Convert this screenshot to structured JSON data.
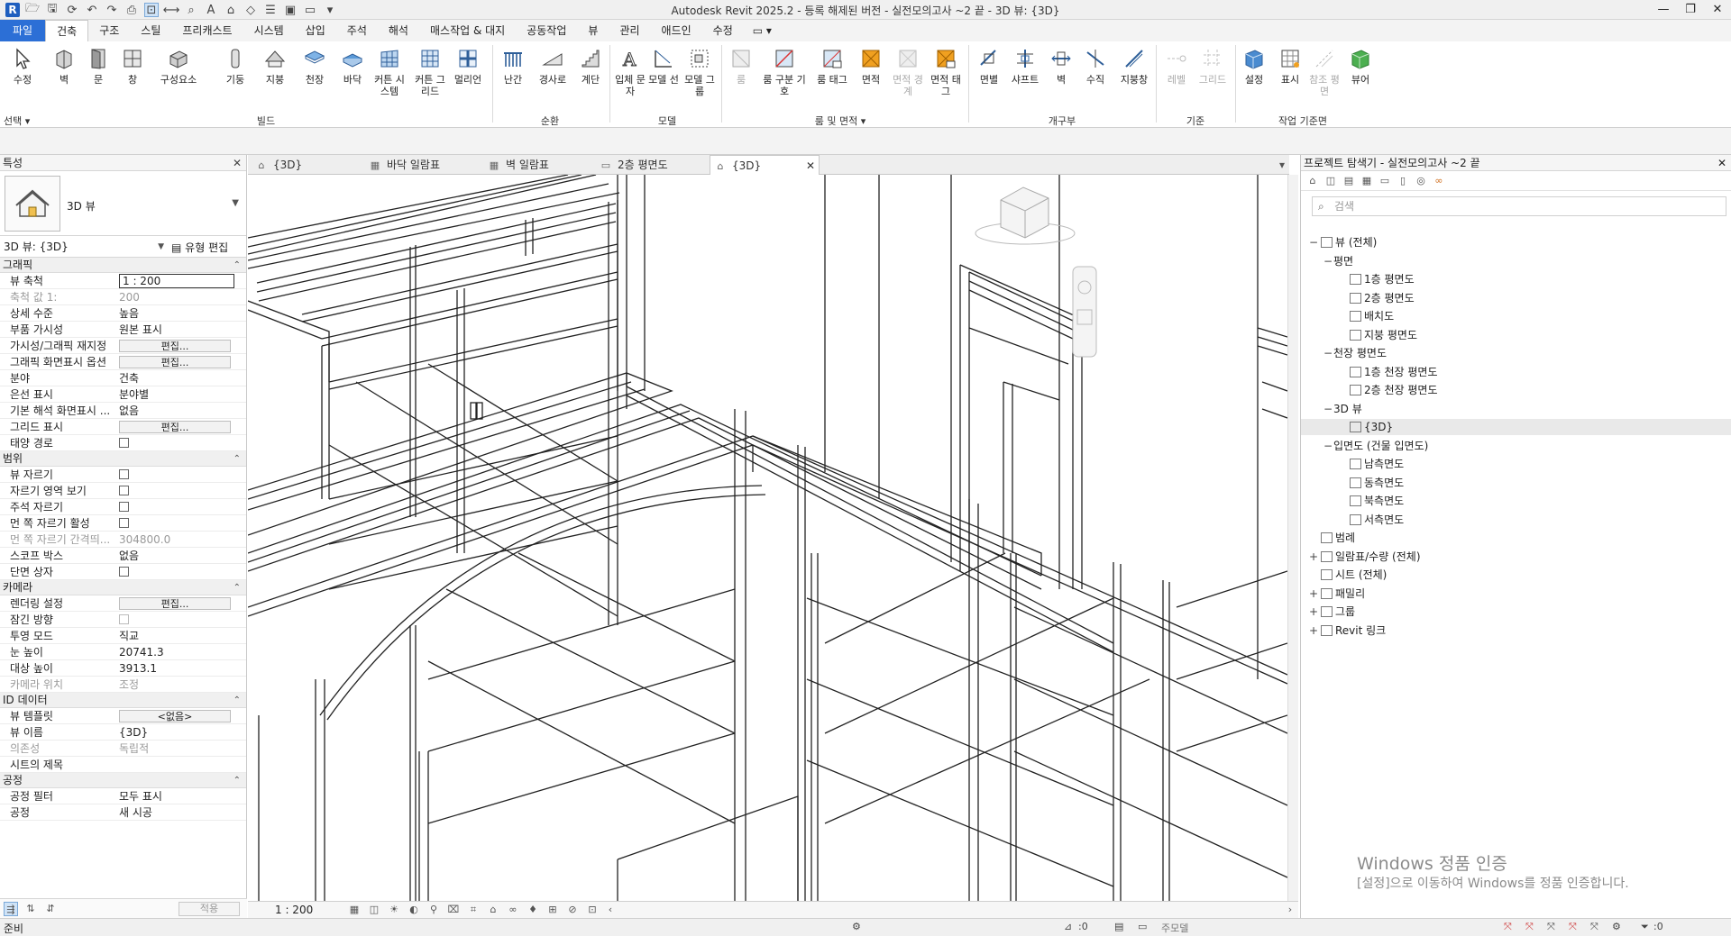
{
  "app": {
    "title": "Autodesk Revit 2025.2 - 등록 해제된 버전 - 실전모의고사 ~2 끝 - 3D 뷰: {3D}",
    "logo": "R",
    "window_controls": [
      "—",
      "❐",
      "✕"
    ]
  },
  "ribbon_tabs": [
    "파일",
    "건축",
    "구조",
    "스틸",
    "프리캐스트",
    "시스템",
    "삽입",
    "주석",
    "해석",
    "매스작업 & 대지",
    "공동작업",
    "뷰",
    "관리",
    "애드인",
    "수정"
  ],
  "ribbon_tab_extra": "▭ ▾",
  "ribbon": {
    "select_label": "선택",
    "panels": [
      {
        "name": "빌드",
        "buttons": [
          "수정",
          "벽",
          "문",
          "창",
          "구성요소",
          "기둥",
          "지붕",
          "천장",
          "바닥",
          "커튼 시스템",
          "커튼 그리드",
          "멀리언"
        ]
      },
      {
        "name": "순환",
        "buttons": [
          "난간",
          "경사로",
          "계단"
        ]
      },
      {
        "name": "모델",
        "buttons": [
          "입체 문자",
          "모델 선",
          "모델 그룹"
        ]
      },
      {
        "name": "룸 및 면적",
        "buttons": [
          "룸",
          "룸 구분 기호",
          "룸 태그",
          "면적",
          "면적 경계",
          "면적 태그"
        ]
      },
      {
        "name": "개구부",
        "buttons": [
          "면별",
          "샤프트",
          "벽",
          "수직",
          "지붕창"
        ]
      },
      {
        "name": "기준",
        "buttons": [
          "레벨",
          "그리드"
        ]
      },
      {
        "name": "작업 기준면",
        "buttons": [
          "설정",
          "표시",
          "참조 평면",
          "뷰어"
        ]
      }
    ]
  },
  "properties": {
    "title": "특성",
    "type_name": "3D 뷰",
    "instance_selector": "3D 뷰: {3D}",
    "edit_type_label": "유형 편집",
    "apply_label": "적용",
    "sections": [
      {
        "name": "그래픽",
        "rows": [
          {
            "key": "뷰 축척",
            "value": "1 : 200",
            "kind": "input"
          },
          {
            "key": "축척 값    1:",
            "value": "200",
            "kind": "disabled"
          },
          {
            "key": "상세 수준",
            "value": "높음",
            "kind": "text"
          },
          {
            "key": "부품 가시성",
            "value": "원본 표시",
            "kind": "text"
          },
          {
            "key": "가시성/그래픽 재지정",
            "value": "편집...",
            "kind": "button"
          },
          {
            "key": "그래픽 화면표시 옵션",
            "value": "편집...",
            "kind": "button"
          },
          {
            "key": "분야",
            "value": "건축",
            "kind": "text"
          },
          {
            "key": "은선 표시",
            "value": "분야별",
            "kind": "text"
          },
          {
            "key": "기본 해석 화면표시 ...",
            "value": "없음",
            "kind": "text"
          },
          {
            "key": "그리드 표시",
            "value": "편집...",
            "kind": "button"
          },
          {
            "key": "태양 경로",
            "value": "",
            "kind": "checkbox"
          }
        ]
      },
      {
        "name": "범위",
        "rows": [
          {
            "key": "뷰 자르기",
            "value": "",
            "kind": "checkbox"
          },
          {
            "key": "자르기 영역 보기",
            "value": "",
            "kind": "checkbox"
          },
          {
            "key": "주석 자르기",
            "value": "",
            "kind": "checkbox"
          },
          {
            "key": "먼 쪽 자르기 활성",
            "value": "",
            "kind": "checkbox"
          },
          {
            "key": "먼 쪽 자르기 간격띄...",
            "value": "304800.0",
            "kind": "disabled"
          },
          {
            "key": "스코프 박스",
            "value": "없음",
            "kind": "text"
          },
          {
            "key": "단면 상자",
            "value": "",
            "kind": "checkbox"
          }
        ]
      },
      {
        "name": "카메라",
        "rows": [
          {
            "key": "렌더링 설정",
            "value": "편집...",
            "kind": "button"
          },
          {
            "key": "잠긴 방향",
            "value": "",
            "kind": "checkbox-disabled"
          },
          {
            "key": "투영 모드",
            "value": "직교",
            "kind": "text"
          },
          {
            "key": "눈 높이",
            "value": "20741.3",
            "kind": "text"
          },
          {
            "key": "대상 높이",
            "value": "3913.1",
            "kind": "text"
          },
          {
            "key": "카메라 위치",
            "value": "조정",
            "kind": "disabled"
          }
        ]
      },
      {
        "name": "ID 데이터",
        "rows": [
          {
            "key": "뷰 템플릿",
            "value": "<없음>",
            "kind": "button"
          },
          {
            "key": "뷰 이름",
            "value": "{3D}",
            "kind": "text"
          },
          {
            "key": "의존성",
            "value": "독립적",
            "kind": "disabled"
          },
          {
            "key": "시트의 제목",
            "value": "",
            "kind": "text"
          }
        ]
      },
      {
        "name": "공정",
        "rows": [
          {
            "key": "공정 필터",
            "value": "모두 표시",
            "kind": "text"
          },
          {
            "key": "공정",
            "value": "새 시공",
            "kind": "text"
          }
        ]
      }
    ]
  },
  "view_tabs": [
    {
      "label": "{3D}",
      "icon": "⌂",
      "active": false
    },
    {
      "label": "바닥 일람표",
      "icon": "▦",
      "active": false
    },
    {
      "label": "벽 일람표",
      "icon": "▦",
      "active": false
    },
    {
      "label": "2층 평면도",
      "icon": "▭",
      "active": false
    },
    {
      "label": "{3D}",
      "icon": "⌂",
      "active": true
    }
  ],
  "view_bar": {
    "scale": "1 : 200"
  },
  "browser": {
    "title": "프로젝트 탐색기 - 실전모의고사 ~2 끝",
    "search_placeholder": "검색",
    "tree": [
      {
        "label": "뷰 (전체)",
        "level": 0,
        "toggle": "−",
        "icon": true
      },
      {
        "label": "평면",
        "level": 1,
        "toggle": "−",
        "icon": false
      },
      {
        "label": "1층 평면도",
        "level": 2,
        "toggle": "",
        "icon": true
      },
      {
        "label": "2층 평면도",
        "level": 2,
        "toggle": "",
        "icon": true
      },
      {
        "label": "배치도",
        "level": 2,
        "toggle": "",
        "icon": true
      },
      {
        "label": "지붕 평면도",
        "level": 2,
        "toggle": "",
        "icon": true
      },
      {
        "label": "천장 평면도",
        "level": 1,
        "toggle": "−",
        "icon": false
      },
      {
        "label": "1층 천장 평면도",
        "level": 2,
        "toggle": "",
        "icon": true
      },
      {
        "label": "2층 천장 평면도",
        "level": 2,
        "toggle": "",
        "icon": true
      },
      {
        "label": "3D 뷰",
        "level": 1,
        "toggle": "−",
        "icon": false
      },
      {
        "label": "{3D}",
        "level": 2,
        "toggle": "",
        "icon": true,
        "selected": true
      },
      {
        "label": "입면도 (건물 입면도)",
        "level": 1,
        "toggle": "−",
        "icon": false
      },
      {
        "label": "남측면도",
        "level": 2,
        "toggle": "",
        "icon": true
      },
      {
        "label": "동측면도",
        "level": 2,
        "toggle": "",
        "icon": true
      },
      {
        "label": "북측면도",
        "level": 2,
        "toggle": "",
        "icon": true
      },
      {
        "label": "서측면도",
        "level": 2,
        "toggle": "",
        "icon": true
      },
      {
        "label": "범례",
        "level": 0,
        "toggle": "",
        "icon": true
      },
      {
        "label": "일람표/수량 (전체)",
        "level": 0,
        "toggle": "+",
        "icon": true
      },
      {
        "label": "시트 (전체)",
        "level": 0,
        "toggle": "",
        "icon": true
      },
      {
        "label": "패밀리",
        "level": 0,
        "toggle": "+",
        "icon": true
      },
      {
        "label": "그룹",
        "level": 0,
        "toggle": "+",
        "icon": true
      },
      {
        "label": "Revit 링크",
        "level": 0,
        "toggle": "+",
        "icon": true
      }
    ],
    "watermark_title": "Windows 정품 인증",
    "watermark_body": "[설정]으로 이동하여 Windows를 정품 인증합니다."
  },
  "status": {
    "ready": "준비",
    "sel_count": ":0",
    "model_label": "주모델",
    "filter_count": ":0"
  },
  "colors": {
    "file_tab": "#2c6fd6",
    "accent_orange": "#f0a020",
    "icon_blue": "#3d7fc4"
  }
}
